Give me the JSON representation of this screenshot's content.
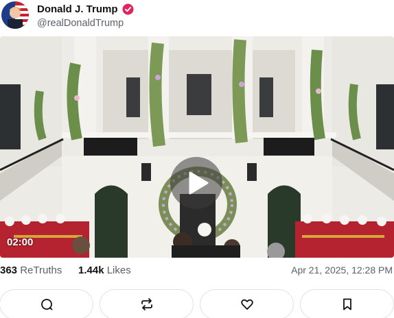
{
  "post": {
    "author": {
      "display_name": "Donald J. Trump",
      "handle": "@realDonaldTrump",
      "verified": true,
      "verified_color": "#e0245e"
    },
    "video": {
      "timecode": "02:00",
      "play_icon": "play-icon"
    },
    "stats": {
      "retruths_count": "363",
      "retruths_label": "ReTruths",
      "likes_count": "1.44k",
      "likes_label": "Likes"
    },
    "timestamp": "Apr 21, 2025, 12:28 PM",
    "actions": [
      {
        "icon": "reply-icon"
      },
      {
        "icon": "retruth-icon"
      },
      {
        "icon": "heart-icon"
      },
      {
        "icon": "bookmark-icon"
      }
    ]
  }
}
